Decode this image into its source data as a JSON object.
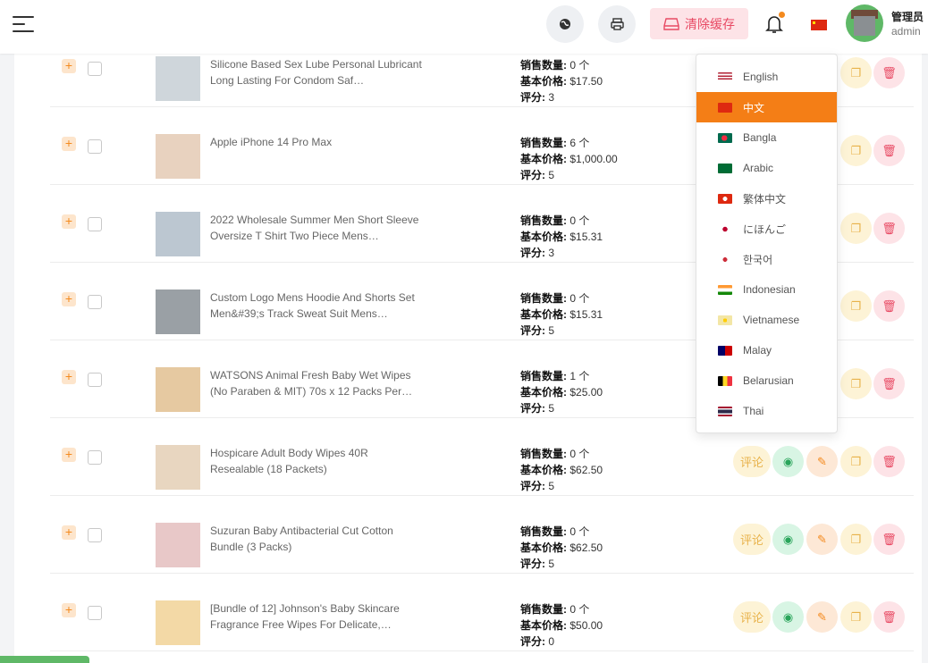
{
  "header": {
    "clear_cache_label": "清除缓存",
    "user_name": "管理员",
    "user_role": "admin",
    "icons": [
      "menu-icon",
      "globe-icon",
      "printer-icon",
      "clear-cache-icon",
      "bell-icon",
      "china-flag-icon",
      "avatar"
    ]
  },
  "stats_labels": {
    "sales": "销售数量:",
    "price": "基本价格:",
    "rating": "评分:"
  },
  "actions": {
    "review_label": "评论"
  },
  "products": [
    {
      "name": "Silicone Based Sex Lube Personal Lubricant Long Lasting For Condom Saf…",
      "sales": "0 个",
      "price": "$17.50",
      "rating": "3"
    },
    {
      "name": "Apple iPhone 14 Pro Max",
      "sales": "6 个",
      "price": "$1,000.00",
      "rating": "5"
    },
    {
      "name": "2022 Wholesale Summer Men Short Sleeve Oversize T Shirt Two Piece Mens…",
      "sales": "0 个",
      "price": "$15.31",
      "rating": "3"
    },
    {
      "name": "Custom Logo Mens Hoodie And Shorts Set Men&#39;s Track Sweat Suit Mens…",
      "sales": "0 个",
      "price": "$15.31",
      "rating": "5"
    },
    {
      "name": "WATSONS Animal Fresh Baby Wet Wipes (No Paraben & MIT) 70s x 12 Packs Per…",
      "sales": "1 个",
      "price": "$25.00",
      "rating": "5"
    },
    {
      "name": "Hospicare Adult Body Wipes 40R Resealable (18 Packets)",
      "sales": "0 个",
      "price": "$62.50",
      "rating": "5"
    },
    {
      "name": "Suzuran Baby Antibacterial Cut Cotton Bundle (3 Packs)",
      "sales": "0 个",
      "price": "$62.50",
      "rating": "5"
    },
    {
      "name": "[Bundle of 12] Johnson's Baby Skincare Fragrance Free Wipes For Delicate,…",
      "sales": "0 个",
      "price": "$50.00",
      "rating": "0"
    }
  ],
  "language_menu": {
    "active": "中文",
    "items": [
      {
        "label": "English",
        "flag": "us-flag-icon"
      },
      {
        "label": "中文",
        "flag": "china-flag-icon"
      },
      {
        "label": "Bangla",
        "flag": "bangladesh-flag-icon"
      },
      {
        "label": "Arabic",
        "flag": "saudi-flag-icon"
      },
      {
        "label": "繁体中文",
        "flag": "hongkong-flag-icon"
      },
      {
        "label": "にほんご",
        "flag": "japan-flag-icon"
      },
      {
        "label": "한국어",
        "flag": "korea-flag-icon"
      },
      {
        "label": "Indonesian",
        "flag": "india-flag-icon"
      },
      {
        "label": "Vietnamese",
        "flag": "vietnam-flag-icon"
      },
      {
        "label": "Malay",
        "flag": "malaysia-flag-icon"
      },
      {
        "label": "Belarusian",
        "flag": "belgium-flag-icon"
      },
      {
        "label": "Thai",
        "flag": "thailand-flag-icon"
      }
    ]
  },
  "colors": {
    "accent_orange": "#f47e16",
    "danger_pink": "#e84a64",
    "success_green": "#2aa55b"
  }
}
